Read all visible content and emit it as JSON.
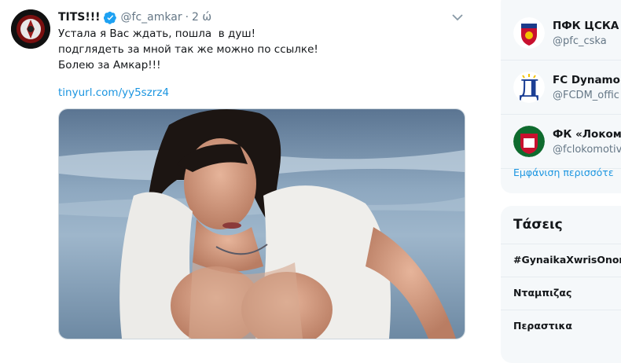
{
  "tweet": {
    "display_name": "TITS!!!",
    "handle": "@fc_amkar",
    "separator": "·",
    "time": "2 ώ",
    "text_lines": [
      "Устала я Вас ждать, пошла  в душ!",
      "подглядеть за мной так же можно по ссылке!",
      "Болею за Амкар!!!"
    ],
    "link": "tinyurl.com/yy5szrz4"
  },
  "who_to_follow": {
    "accounts": [
      {
        "name": "ПФК ЦСКА",
        "handle": "@pfc_cska"
      },
      {
        "name": "FC Dynamo",
        "handle": "@FCDM_offic"
      },
      {
        "name": "ФК «Локомо",
        "handle": "@fclokomotiv"
      }
    ],
    "show_more": "Εμφάνιση περισσότε"
  },
  "trends": {
    "title": "Τάσεις",
    "items": [
      "#GynaikaXwrisOnor",
      "Νταμπιζας",
      "Περαστικα"
    ]
  },
  "colors": {
    "accent": "#1b95e0",
    "verified": "#1da1f2",
    "muted": "#657786"
  }
}
